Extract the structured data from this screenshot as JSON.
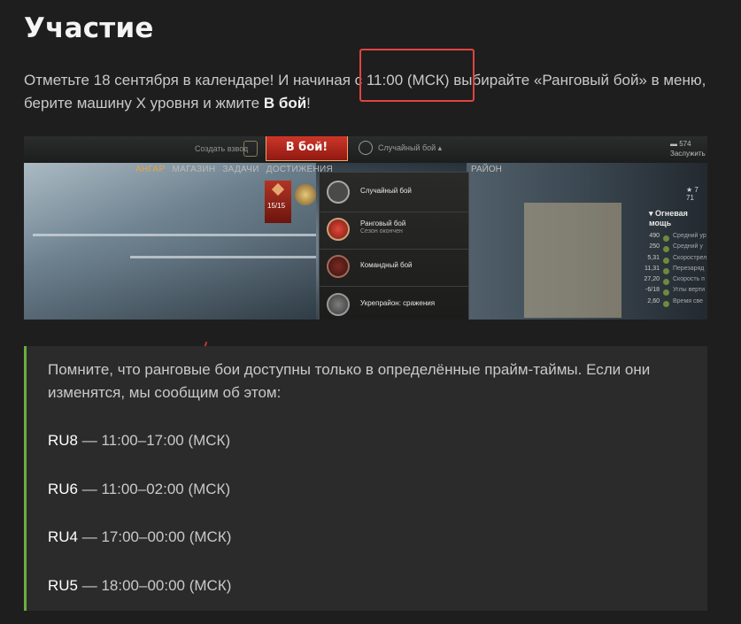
{
  "heading": "Участие",
  "intro": {
    "part1": "Отметьте 18 сентября в календаре! И начиная",
    "highlight": "с 11:00 (МСК)",
    "part2": "выбирайте «Ранговый бой» в меню, берите машину X уровня и жмите",
    "bold": "В бой",
    "end": "!"
  },
  "screenshot": {
    "create_platoon": "Создать взвод",
    "battle_button": "В бой!",
    "mode_selected": "Случайный бой",
    "free_xp_value": "574",
    "free_xp_label": "Заслужить",
    "menu": [
      "АНГАР",
      "МАГАЗИН",
      "ЗАДАЧИ",
      "ДОСТИЖЕНИЯ"
    ],
    "menu_right": "РАЙОН",
    "rank_progress": "15/15",
    "dropdown": [
      {
        "label": "Случайный бой",
        "sub": ""
      },
      {
        "label": "Ранговый бой",
        "sub": "Сезон окончен"
      },
      {
        "label": "Командный бой",
        "sub": ""
      },
      {
        "label": "Укрепрайон: сражения",
        "sub": ""
      }
    ],
    "rating": "7 71",
    "firepower": "Огневая мощь",
    "stats": [
      {
        "value": "490",
        "name": "Средний ур"
      },
      {
        "value": "250",
        "name": "Средний у"
      },
      {
        "value": "5,31",
        "name": "Скорострел"
      },
      {
        "value": "11,31",
        "name": "Перезаряд"
      },
      {
        "value": "27,20",
        "name": "Скорость п"
      },
      {
        "value": "-6/18",
        "name": "Углы верти"
      },
      {
        "value": "2,60",
        "name": "Время све"
      }
    ]
  },
  "notice": {
    "text": "Помните, что ранговые бои доступны только в определённые прайм-таймы. Если они изменятся, мы сообщим об этом:",
    "servers": [
      {
        "name": "RU8",
        "time": " — 11:00–17:00 (МСК)"
      },
      {
        "name": "RU6",
        "time": " — 11:00–02:00 (МСК)"
      },
      {
        "name": "RU4",
        "time": " — 17:00–00:00 (МСК)"
      },
      {
        "name": "RU5",
        "time": " — 18:00–00:00 (МСК)"
      }
    ]
  },
  "colors": {
    "accent_green": "#6cae3c",
    "highlight_red": "#e0443e",
    "background": "#1e1e1e"
  }
}
